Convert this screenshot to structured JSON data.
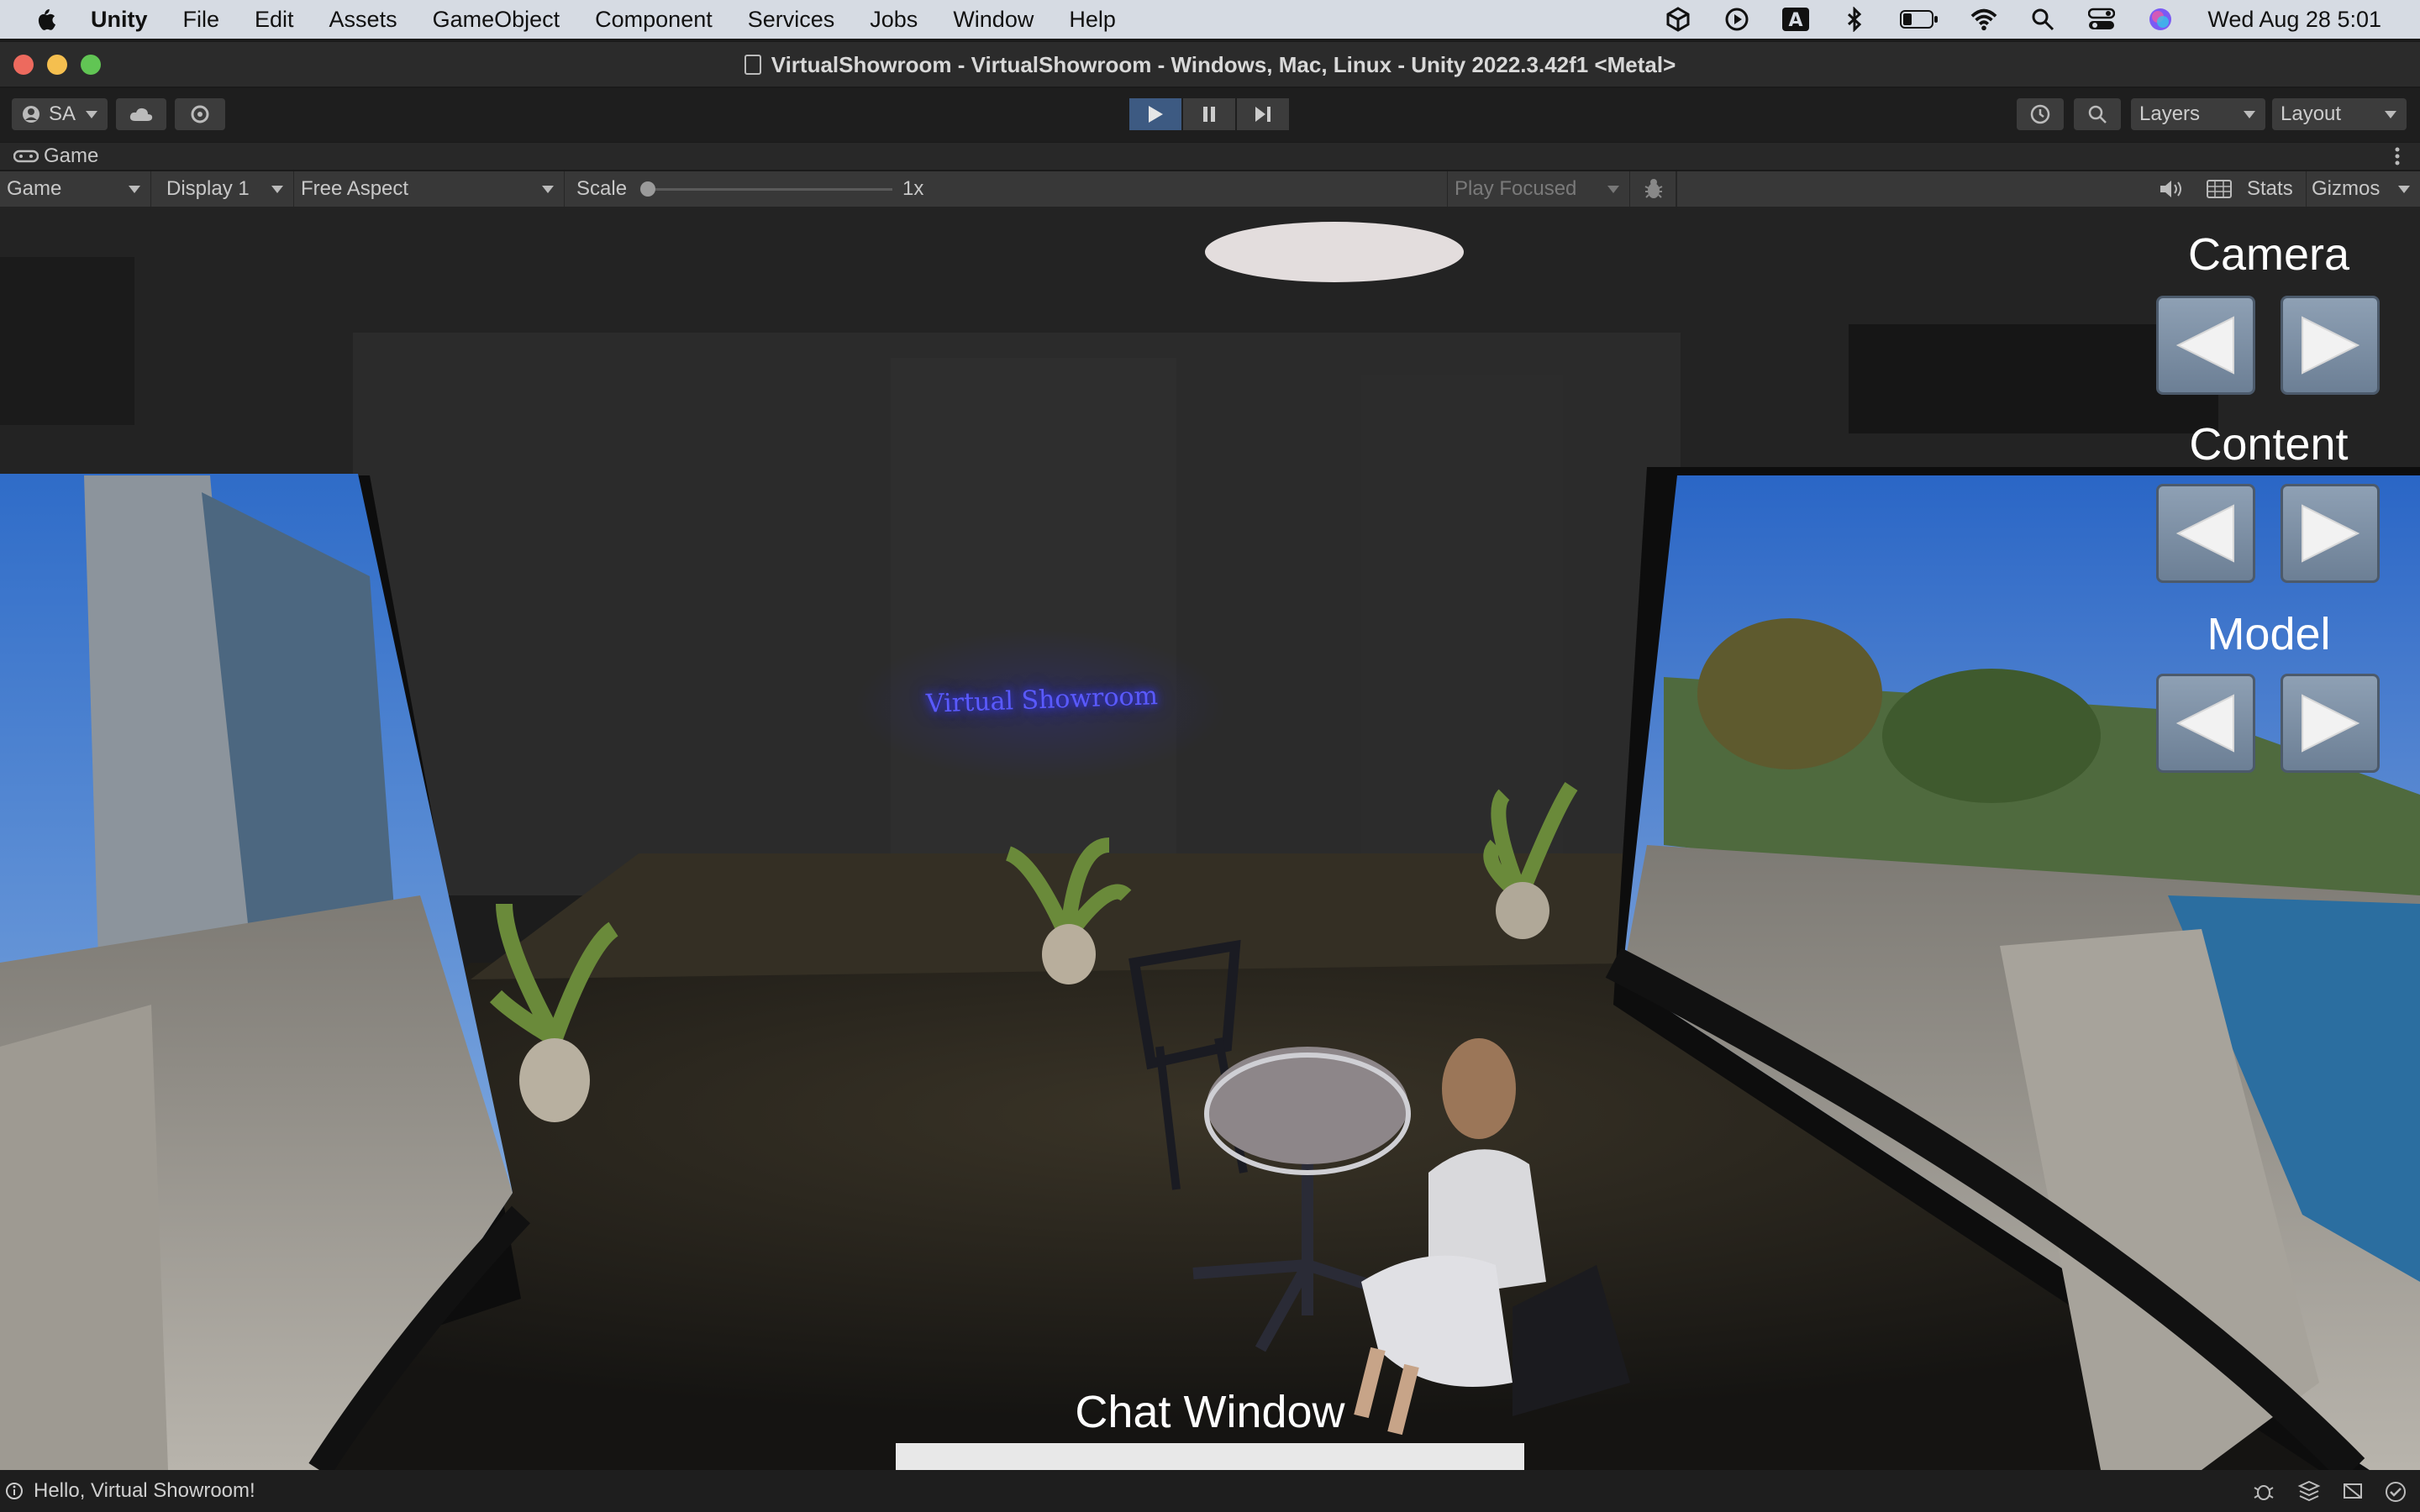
{
  "menubar": {
    "app": "Unity",
    "items": [
      "File",
      "Edit",
      "Assets",
      "GameObject",
      "Component",
      "Services",
      "Jobs",
      "Window",
      "Help"
    ],
    "clock": "Wed Aug 28  5:01",
    "icons": [
      "unity-icon",
      "play-circle-icon",
      "input-a-icon",
      "bluetooth-icon",
      "battery-icon",
      "wifi-icon",
      "search-icon",
      "control-center-icon",
      "siri-icon"
    ]
  },
  "window": {
    "title": "VirtualShowroom - VirtualShowroom - Windows, Mac, Linux - Unity 2022.3.42f1 <Metal>"
  },
  "toolbar": {
    "account": "SA",
    "layers": "Layers",
    "layout": "Layout"
  },
  "tab": {
    "label": "Game"
  },
  "gamebar": {
    "mode": "Game",
    "display": "Display 1",
    "aspect": "Free Aspect",
    "scale_label": "Scale",
    "scale_value": "1x",
    "play_focused": "Play Focused",
    "stats": "Stats",
    "gizmos": "Gizmos"
  },
  "scene": {
    "sign": "Virtual Showroom",
    "panels": [
      {
        "title": "Camera"
      },
      {
        "title": "Content"
      },
      {
        "title": "Model"
      }
    ],
    "chat_title": "Chat Window"
  },
  "status": {
    "message": "Hello, Virtual Showroom!"
  },
  "colors": {
    "play_active": "#3d5a82",
    "sign_glow": "#4c4cff",
    "nav_button": "#7d8fa4"
  }
}
